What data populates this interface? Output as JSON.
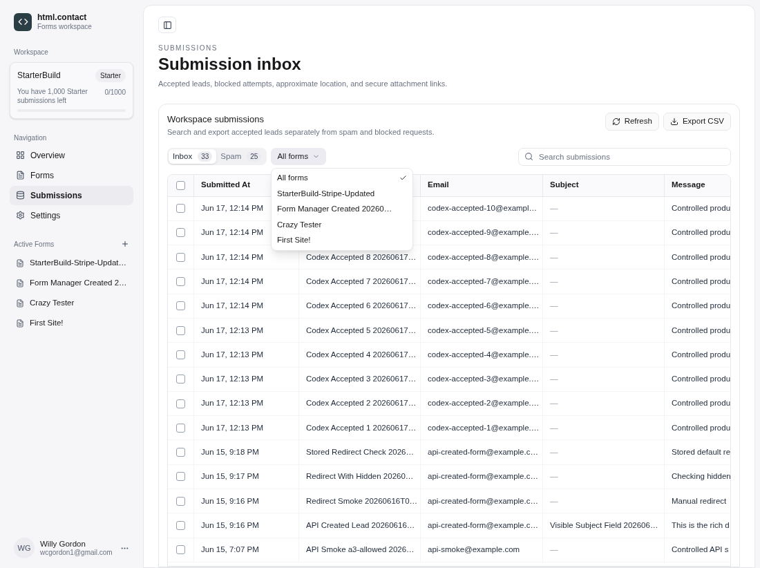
{
  "sidebar": {
    "brand": {
      "name": "html.contact",
      "subtitle": "Forms workspace"
    },
    "workspace_label": "Workspace",
    "workspace": {
      "name": "StarterBuild",
      "plan": "Starter",
      "usage_text": "You have 1,000 Starter submissions left",
      "usage_count": "0/1000",
      "level": 0
    },
    "navigation_label": "Navigation",
    "nav": [
      {
        "label": "Overview",
        "selected": false
      },
      {
        "label": "Forms",
        "selected": false
      },
      {
        "label": "Submissions",
        "selected": true
      },
      {
        "label": "Settings",
        "selected": false
      }
    ],
    "active_forms_label": "Active Forms",
    "active_forms": [
      "StarterBuild-Stripe-Updat…",
      "Form Manager Created 2…",
      "Crazy Tester",
      "First Site!"
    ],
    "user": {
      "initials": "WG",
      "name": "Willy Gordon",
      "email": "wcgordon1@gmail.com"
    }
  },
  "main": {
    "section_label": "SUBMISSIONS",
    "title": "Submission inbox",
    "description": "Accepted leads, blocked attempts, approximate location, and secure attachment links.",
    "card": {
      "title": "Workspace submissions",
      "subtitle": "Search and export accepted leads separately from spam and blocked requests.",
      "buttons": [
        {
          "label": "Refresh"
        },
        {
          "label": "Export CSV"
        }
      ],
      "tabs": [
        {
          "label": "Inbox",
          "count": "33",
          "selected": true
        },
        {
          "label": "Spam",
          "count": "25",
          "selected": false
        }
      ],
      "filter": {
        "label": "All forms"
      },
      "dropdown": [
        {
          "label": "All forms",
          "selected": true
        },
        {
          "label": "StarterBuild-Stripe-Updated",
          "selected": false
        },
        {
          "label": "Form Manager Created 20260…",
          "selected": false
        },
        {
          "label": "Crazy Tester",
          "selected": false
        },
        {
          "label": "First Site!",
          "selected": false
        }
      ],
      "search": {
        "placeholder": "Search submissions"
      },
      "table": {
        "select_all": {
          "checked": false
        },
        "columns": [
          {
            "label": "Submitted At"
          },
          {},
          {
            "label": "Email"
          },
          {
            "label": "Subject"
          },
          {
            "label": "Message"
          }
        ],
        "rows": [
          {
            "checked": false,
            "submitted": "Jun 17, 12:14 PM",
            "email": "codex-accepted-10@exampl…",
            "subject": "—",
            "message": "Controlled produ"
          },
          {
            "checked": false,
            "submitted": "Jun 17, 12:14 PM",
            "email": "codex-accepted-9@example.…",
            "subject": "—",
            "message": "Controlled produ"
          },
          {
            "checked": false,
            "submitted": "Jun 17, 12:14 PM",
            "form": "Codex Accepted 8 20260617…",
            "email": "codex-accepted-8@example.…",
            "subject": "—",
            "message": "Controlled produ"
          },
          {
            "checked": false,
            "submitted": "Jun 17, 12:14 PM",
            "form": "Codex Accepted 7 20260617…",
            "email": "codex-accepted-7@example.…",
            "subject": "—",
            "message": "Controlled produ"
          },
          {
            "checked": false,
            "submitted": "Jun 17, 12:14 PM",
            "form": "Codex Accepted 6 20260617…",
            "email": "codex-accepted-6@example.…",
            "subject": "—",
            "message": "Controlled produ"
          },
          {
            "checked": false,
            "submitted": "Jun 17, 12:13 PM",
            "form": "Codex Accepted 5 20260617…",
            "email": "codex-accepted-5@example.…",
            "subject": "—",
            "message": "Controlled produ"
          },
          {
            "checked": false,
            "submitted": "Jun 17, 12:13 PM",
            "form": "Codex Accepted 4 20260617…",
            "email": "codex-accepted-4@example.…",
            "subject": "—",
            "message": "Controlled produ"
          },
          {
            "checked": false,
            "submitted": "Jun 17, 12:13 PM",
            "form": "Codex Accepted 3 20260617…",
            "email": "codex-accepted-3@example.…",
            "subject": "—",
            "message": "Controlled produ"
          },
          {
            "checked": false,
            "submitted": "Jun 17, 12:13 PM",
            "form": "Codex Accepted 2 20260617…",
            "email": "codex-accepted-2@example.…",
            "subject": "—",
            "message": "Controlled produ"
          },
          {
            "checked": false,
            "submitted": "Jun 17, 12:13 PM",
            "form": "Codex Accepted 1 20260617…",
            "email": "codex-accepted-1@example.…",
            "subject": "—",
            "message": "Controlled produ"
          },
          {
            "checked": false,
            "submitted": "Jun 15, 9:18 PM",
            "form": "Stored Redirect Check 2026…",
            "email": "api-created-form@example.c…",
            "subject": "—",
            "message": "Stored default re"
          },
          {
            "checked": false,
            "submitted": "Jun 15, 9:17 PM",
            "form": "Redirect With Hidden 20260…",
            "email": "api-created-form@example.c…",
            "subject": "—",
            "message": "Checking hidden"
          },
          {
            "checked": false,
            "submitted": "Jun 15, 9:16 PM",
            "form": "Redirect Smoke 20260616T0…",
            "email": "api-created-form@example.c…",
            "subject": "—",
            "message": "Manual redirect"
          },
          {
            "checked": false,
            "submitted": "Jun 15, 9:16 PM",
            "form": "API Created Lead 20260616…",
            "email": "api-created-form@example.c…",
            "subject": "Visible Subject Field 202606…",
            "message": "This is the rich d"
          },
          {
            "checked": false,
            "submitted": "Jun 15, 7:07 PM",
            "form": "API Smoke a3-allowed 2026…",
            "email": "api-smoke@example.com",
            "subject": "—",
            "message": "Controlled API s"
          }
        ]
      }
    }
  }
}
